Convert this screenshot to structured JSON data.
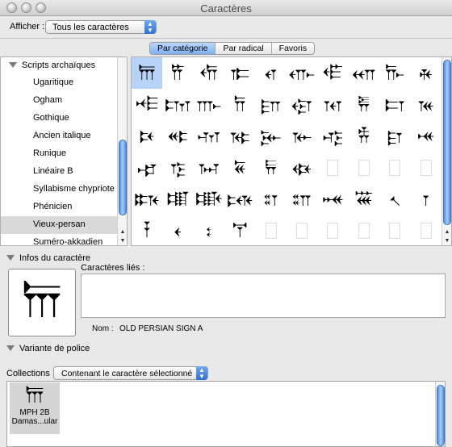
{
  "window": {
    "title": "Caractères"
  },
  "toolbar": {
    "show_label": "Afficher :",
    "show_value": "Tous les caractères"
  },
  "tabs": [
    "Par catégorie",
    "Par radical",
    "Favoris"
  ],
  "active_tab": 0,
  "categories": {
    "header": "Scripts archaïques",
    "items": [
      "Ugaritique",
      "Ogham",
      "Gothique",
      "Ancien italique",
      "Runique",
      "Linéaire B",
      "Syllabisme chypriote",
      "Phénicien",
      "Vieux-persan",
      "Suméro-akkadien"
    ],
    "selected_index": 8
  },
  "glyph_rows": [
    [
      "𐎠",
      "𐎡",
      "𐎢",
      "𐎣",
      "𐎤",
      "𐎥",
      "𐎦",
      "𐎧",
      "𐎨",
      "𐎩"
    ],
    [
      "𐎪",
      "𐎫",
      "𐎬",
      "𐎭",
      "𐎮",
      "𐎯",
      "𐎰",
      "𐎱",
      "𐎲",
      "𐎳"
    ],
    [
      "𐎴",
      "𐎵",
      "𐎶",
      "𐎷",
      "𐎸",
      "𐎹",
      "𐎺",
      "𐎻",
      "𐎼",
      "𐎽"
    ],
    [
      "𐎾",
      "𐎿",
      "𐏀",
      "𐏁",
      "𐏂",
      "𐏃",
      "",
      "",
      "",
      ""
    ],
    [
      "𐏈",
      "𐏉",
      "𐏊",
      "𐏋",
      "𐏌",
      "𐏍",
      "𐏎",
      "𐏏",
      "𐏐",
      "𐏑"
    ],
    [
      "𐏒",
      "𐏓",
      "𐏔",
      "𐏕",
      "",
      "",
      "",
      "",
      "",
      ""
    ]
  ],
  "selected_glyph": "𐎠",
  "info": {
    "section_label": "Infos du caractère",
    "related_label": "Caractères liés :",
    "name_label": "Nom :",
    "name_value": "OLD PERSIAN SIGN A"
  },
  "font_variant": {
    "section_label": "Variante de police",
    "collections_label": "Collections :",
    "collections_value": "Contenant le caractère sélectionné",
    "fonts": [
      {
        "glyph": "𐎠",
        "name_line1": "MPH 2B",
        "name_line2": "Damas...ular"
      }
    ]
  },
  "icons": {
    "disclosure": "triangle-down-icon",
    "select_arrows": "updown-arrows-icon"
  },
  "colors": {
    "selection_blue": "#b6d2f6",
    "scroll_blue": "#4f8de6",
    "window_bg": "#e8e8e8"
  }
}
